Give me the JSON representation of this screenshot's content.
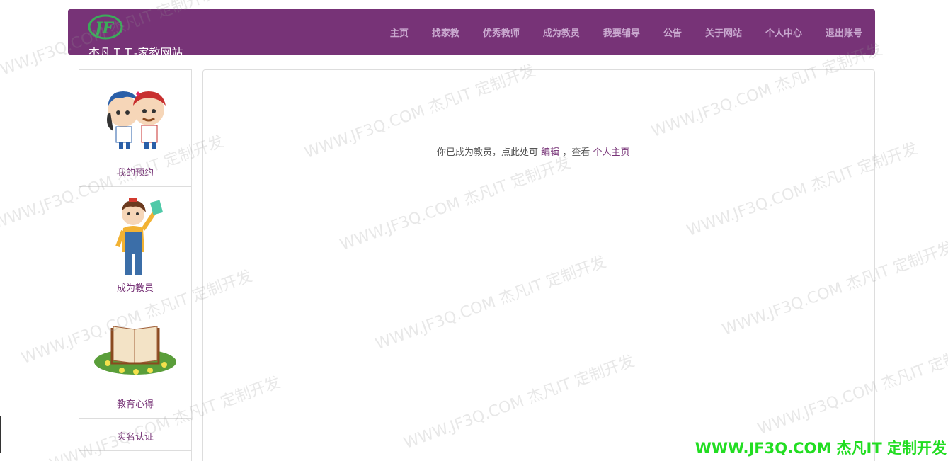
{
  "brand": {
    "title": "杰凡ＩＴ-家教网站",
    "logo_text": "JF"
  },
  "nav": [
    {
      "label": "主页"
    },
    {
      "label": "找家教"
    },
    {
      "label": "优秀教师"
    },
    {
      "label": "成为教员"
    },
    {
      "label": "我要辅导"
    },
    {
      "label": "公告"
    },
    {
      "label": "关于网站"
    },
    {
      "label": "个人中心"
    },
    {
      "label": "退出账号"
    }
  ],
  "sidebar": {
    "items": [
      {
        "label": "我的预约",
        "icon": "kids-icon"
      },
      {
        "label": "成为教员",
        "icon": "girl-book-icon"
      },
      {
        "label": "教育心得",
        "icon": "open-book-icon"
      },
      {
        "label": "实名认证",
        "icon": ""
      }
    ]
  },
  "main": {
    "notice_prefix": "你已成为教员，点此处可",
    "edit_link": "编辑",
    "notice_middle": "，查看",
    "profile_link": "个人主页"
  },
  "watermark": {
    "text": "WWW.JF3Q.COM 杰凡IT  定制开发",
    "corner": "WWW.JF3Q.COM 杰凡IT  定制开发"
  },
  "colors": {
    "primary": "#773377",
    "nav_text": "#c9a8cf",
    "logo_green": "#3cab5a",
    "corner_watermark": "#22dd22"
  }
}
